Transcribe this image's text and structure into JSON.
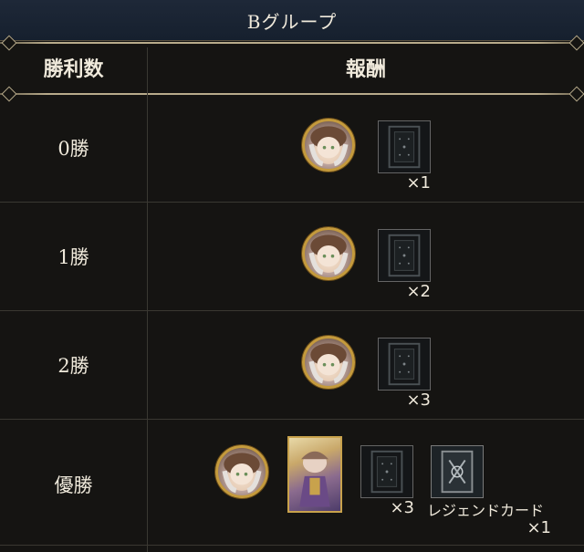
{
  "header": {
    "title": "Bグループ"
  },
  "columns": {
    "wins": "勝利数",
    "reward": "報酬"
  },
  "rows": [
    {
      "wins": "0勝",
      "card_qty": "×1"
    },
    {
      "wins": "1勝",
      "card_qty": "×2"
    },
    {
      "wins": "2勝",
      "card_qty": "×3"
    },
    {
      "wins": "優勝",
      "card_qty": "×3",
      "legend_label": "レジェンドカード",
      "legend_qty": "×1"
    }
  ],
  "icons": {
    "avatar": "character-avatar-icon",
    "card_pack": "card-pack-icon",
    "character_card": "character-card-illustration",
    "legend_card": "legend-card-icon"
  },
  "colors": {
    "header_bg": "#1e2838",
    "frame_gold": "#c49a3c",
    "text": "#efe9db",
    "background": "#151412"
  }
}
